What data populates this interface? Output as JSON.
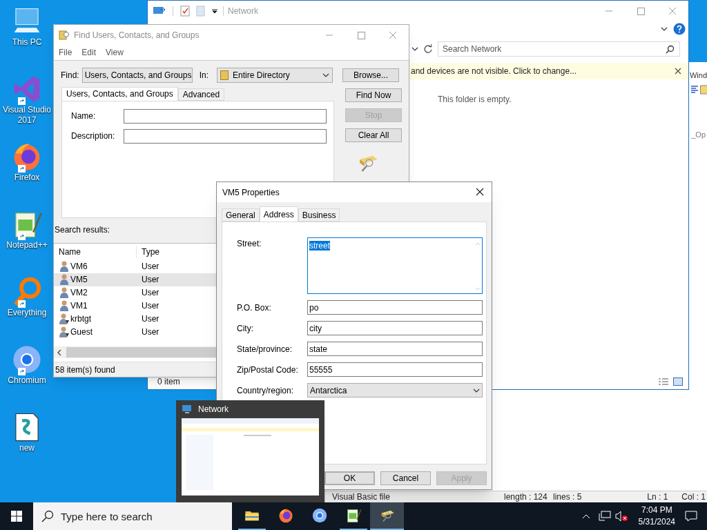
{
  "desktop_icons": [
    {
      "label": "This PC",
      "kind": "computer"
    },
    {
      "label": "Visual Studio 2017",
      "kind": "ribbon"
    },
    {
      "label": "Firefox",
      "kind": "fox"
    },
    {
      "label": "Notepad++",
      "kind": "notepad"
    },
    {
      "label": "Everything",
      "kind": "magnifier"
    },
    {
      "label": "Chromium",
      "kind": "circle"
    },
    {
      "label": "new",
      "kind": "script"
    }
  ],
  "explorer": {
    "title": "Network",
    "search_placeholder": "Search Network",
    "infobar": "and devices are not visible. Click to change...",
    "empty_text": "This folder is empty.",
    "status": "0 item"
  },
  "notepad": {
    "toolbar_text": "Wind",
    "tab_text": "_Op",
    "status": [
      "Visual Basic file",
      "length : 124",
      "lines : 5",
      "Ln : 1",
      "Col : 1"
    ]
  },
  "find_window": {
    "title": "Find Users, Contacts, and Groups",
    "menu": [
      "File",
      "Edit",
      "View"
    ],
    "find_label": "Find:",
    "find_value": "Users, Contacts, and Groups",
    "in_label": "In:",
    "in_value": "Entire Directory",
    "browse": "Browse...",
    "tabs": [
      {
        "label": "Users, Contacts, and Groups",
        "selected": true
      },
      {
        "label": "Advanced",
        "selected": false
      }
    ],
    "fields": [
      {
        "label": "Name:"
      },
      {
        "label": "Description:"
      }
    ],
    "buttons": [
      {
        "label": "Find Now",
        "disabled": false
      },
      {
        "label": "Stop",
        "disabled": true
      },
      {
        "label": "Clear All",
        "disabled": false
      }
    ],
    "results_label": "Search results:",
    "columns": [
      "Name",
      "Type"
    ],
    "rows": [
      {
        "name": "VM6",
        "type": "User",
        "kind": "user",
        "selected": false
      },
      {
        "name": "VM5",
        "type": "User",
        "kind": "user",
        "selected": true
      },
      {
        "name": "VM2",
        "type": "User",
        "kind": "user",
        "selected": false
      },
      {
        "name": "VM1",
        "type": "User",
        "kind": "user",
        "selected": false
      },
      {
        "name": "krbtgt",
        "type": "User",
        "kind": "disabled_user",
        "selected": false
      },
      {
        "name": "Guest",
        "type": "User",
        "kind": "disabled_user",
        "selected": false
      }
    ],
    "status": "58 item(s) found"
  },
  "properties": {
    "title": "VM5 Properties",
    "tabs": [
      {
        "label": "General",
        "selected": false
      },
      {
        "label": "Address",
        "selected": true
      },
      {
        "label": "Business",
        "selected": false
      }
    ],
    "fields": [
      {
        "label": "Street:",
        "value": "street",
        "kind": "multiline",
        "highlighted": true
      },
      {
        "label": "P.O. Box:",
        "value": "po",
        "kind": "text",
        "highlighted": false
      },
      {
        "label": "City:",
        "value": "city",
        "kind": "text",
        "highlighted": false
      },
      {
        "label": "State/province:",
        "value": "state",
        "kind": "text",
        "highlighted": false
      },
      {
        "label": "Zip/Postal Code:",
        "value": "55555",
        "kind": "text",
        "highlighted": false
      },
      {
        "label": "Country/region:",
        "value": "Antarctica",
        "kind": "dropdown",
        "highlighted": false
      }
    ],
    "buttons": [
      {
        "label": "OK",
        "default": true,
        "disabled": false
      },
      {
        "label": "Cancel",
        "default": false,
        "disabled": false
      },
      {
        "label": "Apply",
        "default": false,
        "disabled": true
      }
    ]
  },
  "preview": {
    "title": "Network"
  },
  "taskbar": {
    "search_placeholder": "Type here to search",
    "apps": [
      {
        "kind": "folder",
        "open": true,
        "selected": false
      },
      {
        "kind": "fox",
        "open": false,
        "selected": false
      },
      {
        "kind": "circle",
        "open": false,
        "selected": false
      },
      {
        "kind": "notepad",
        "open": true,
        "selected": false
      },
      {
        "kind": "finder",
        "open": true,
        "selected": true
      }
    ],
    "time": "7:04 PM",
    "date": "5/31/2024"
  }
}
